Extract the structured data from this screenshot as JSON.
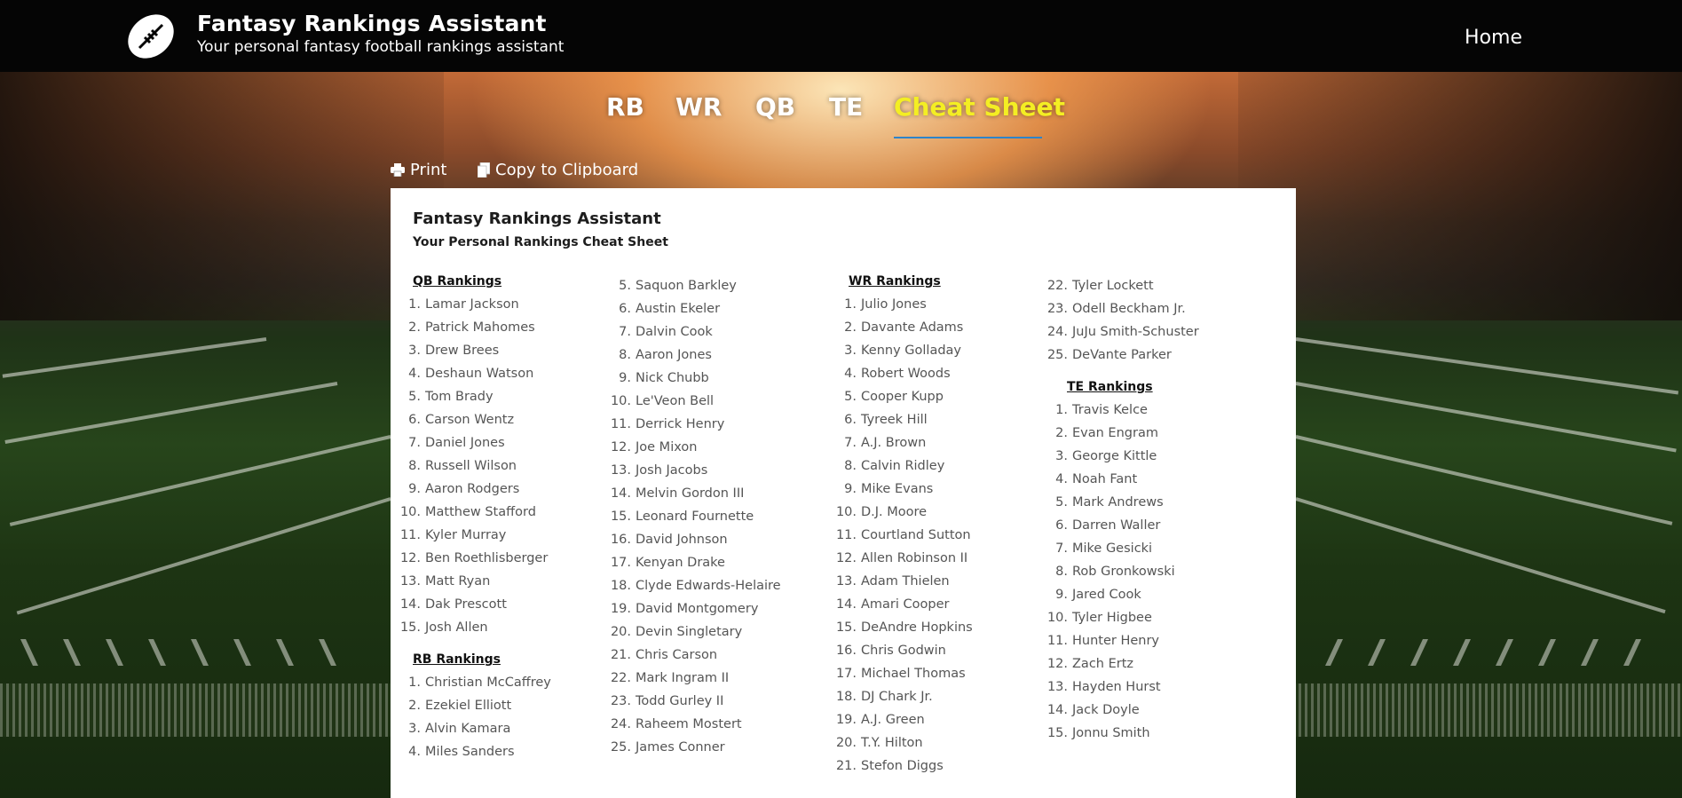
{
  "header": {
    "app_title": "Fantasy Rankings Assistant",
    "app_subtitle": "Your personal fantasy football rankings assistant",
    "nav_home": "Home",
    "logo_icon": "football-icon"
  },
  "tabs": [
    {
      "label": "RB",
      "active": false
    },
    {
      "label": "WR",
      "active": false
    },
    {
      "label": "QB",
      "active": false
    },
    {
      "label": "TE",
      "active": false
    },
    {
      "label": "Cheat Sheet",
      "active": true
    }
  ],
  "actions": {
    "print_label": "Print",
    "print_icon": "printer-icon",
    "copy_label": "Copy to Clipboard",
    "copy_icon": "clipboard-icon"
  },
  "cheat_sheet": {
    "title": "Fantasy Rankings Assistant",
    "subtitle": "Your Personal Rankings Cheat Sheet",
    "qb_heading": "QB Rankings",
    "qb": [
      "Lamar Jackson",
      "Patrick Mahomes",
      "Drew Brees",
      "Deshaun Watson",
      "Tom Brady",
      "Carson Wentz",
      "Daniel Jones",
      "Russell Wilson",
      "Aaron Rodgers",
      "Matthew Stafford",
      "Kyler Murray",
      "Ben Roethlisberger",
      "Matt Ryan",
      "Dak Prescott",
      "Josh Allen"
    ],
    "rb_heading": "RB Rankings",
    "rb": [
      "Christian McCaffrey",
      "Ezekiel Elliott",
      "Alvin Kamara",
      "Miles Sanders",
      "Saquon Barkley",
      "Austin Ekeler",
      "Dalvin Cook",
      "Aaron Jones",
      "Nick Chubb",
      "Le'Veon Bell",
      "Derrick Henry",
      "Joe Mixon",
      "Josh Jacobs",
      "Melvin Gordon III",
      "Leonard Fournette",
      "David Johnson",
      "Kenyan Drake",
      "Clyde Edwards-Helaire",
      "David Montgomery",
      "Devin Singletary",
      "Chris Carson",
      "Mark Ingram II",
      "Todd Gurley II",
      "Raheem Mostert",
      "James Conner"
    ],
    "wr_heading": "WR Rankings",
    "wr": [
      "Julio Jones",
      "Davante Adams",
      "Kenny Golladay",
      "Robert Woods",
      "Cooper Kupp",
      "Tyreek Hill",
      "A.J. Brown",
      "Calvin Ridley",
      "Mike Evans",
      "D.J. Moore",
      "Courtland Sutton",
      "Allen Robinson II",
      "Adam Thielen",
      "Amari Cooper",
      "DeAndre Hopkins",
      "Chris Godwin",
      "Michael Thomas",
      "DJ Chark Jr.",
      "A.J. Green",
      "T.Y. Hilton",
      "Stefon Diggs",
      "Tyler Lockett",
      "Odell Beckham Jr.",
      "JuJu Smith-Schuster",
      "DeVante Parker"
    ],
    "te_heading": "TE Rankings",
    "te": [
      "Travis Kelce",
      "Evan Engram",
      "George Kittle",
      "Noah Fant",
      "Mark Andrews",
      "Darren Waller",
      "Mike Gesicki",
      "Rob Gronkowski",
      "Jared Cook",
      "Tyler Higbee",
      "Hunter Henry",
      "Zach Ertz",
      "Hayden Hurst",
      "Jack Doyle",
      "Jonnu Smith"
    ]
  }
}
